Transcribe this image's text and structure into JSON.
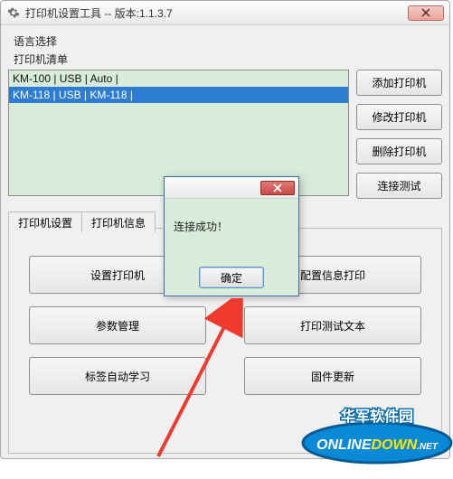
{
  "window": {
    "title": "打印机设置工具 -- 版本:1.1.3.7"
  },
  "labels": {
    "language": "语言选择",
    "printer_list": "打印机清单"
  },
  "printer_list": {
    "items": [
      {
        "text": "KM-100 | USB | Auto |",
        "selected": false
      },
      {
        "text": "KM-118 | USB | KM-118 |",
        "selected": true
      }
    ]
  },
  "side_buttons": {
    "add": "添加打印机",
    "modify": "修改打印机",
    "delete": "删除打印机",
    "test": "连接测试"
  },
  "tabs": {
    "settings": "打印机设置",
    "info": "打印机信息"
  },
  "actions": {
    "set_printer": "设置打印机",
    "config_print": "配置信息打印",
    "param_manage": "参数管理",
    "test_text": "打印测试文本",
    "label_auto": "标签自动学习",
    "firmware": "固件更新"
  },
  "dialog": {
    "message": "连接成功！",
    "ok": "确定"
  },
  "watermark": {
    "line1": "华军软件园",
    "line2_a": "ONLINE",
    "line2_b": "DOWN",
    "line2_c": ".NET"
  }
}
